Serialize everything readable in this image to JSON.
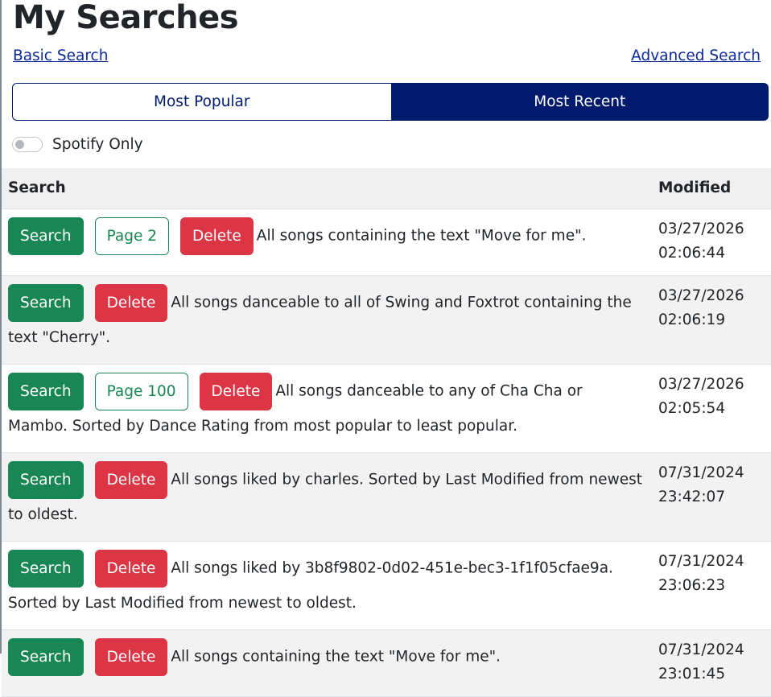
{
  "header": {
    "title": "My Searches",
    "basic_search": "Basic Search",
    "advanced_search": "Advanced Search"
  },
  "tabs": {
    "most_popular": "Most Popular",
    "most_recent": "Most Recent",
    "selected": "Most Recent"
  },
  "filter": {
    "spotify_only_label": "Spotify Only",
    "spotify_only_checked": false
  },
  "table": {
    "columns": {
      "search": "Search",
      "modified": "Modified"
    },
    "search_button": "Search",
    "delete_button": "Delete",
    "rows": [
      {
        "page": "Page 2",
        "description": "All songs containing the text \"Move for me\".",
        "date": "03/27/2026",
        "time": "02:06:44"
      },
      {
        "page": null,
        "description": "All songs danceable to all of Swing and Foxtrot containing the text \"Cherry\".",
        "date": "03/27/2026",
        "time": "02:06:19"
      },
      {
        "page": "Page 100",
        "description": "All songs danceable to any of Cha Cha or Mambo. Sorted by Dance Rating from most popular to least popular.",
        "date": "03/27/2026",
        "time": "02:05:54"
      },
      {
        "page": null,
        "description": "All songs liked by charles. Sorted by Last Modified from newest to oldest.",
        "date": "07/31/2024",
        "time": "23:42:07"
      },
      {
        "page": null,
        "description": "All songs liked by 3b8f9802-0d02-451e-bec3-1f1f05cfae9a. Sorted by Last Modified from newest to oldest.",
        "date": "07/31/2024",
        "time": "23:06:23"
      },
      {
        "page": null,
        "description": "All songs containing the text \"Move for me\".",
        "date": "07/31/2024",
        "time": "23:01:45"
      }
    ]
  },
  "colors": {
    "primary_navy": "#001a6e",
    "success_green": "#198754",
    "danger_red": "#dc3545",
    "link_blue": "#0a2a9b"
  }
}
